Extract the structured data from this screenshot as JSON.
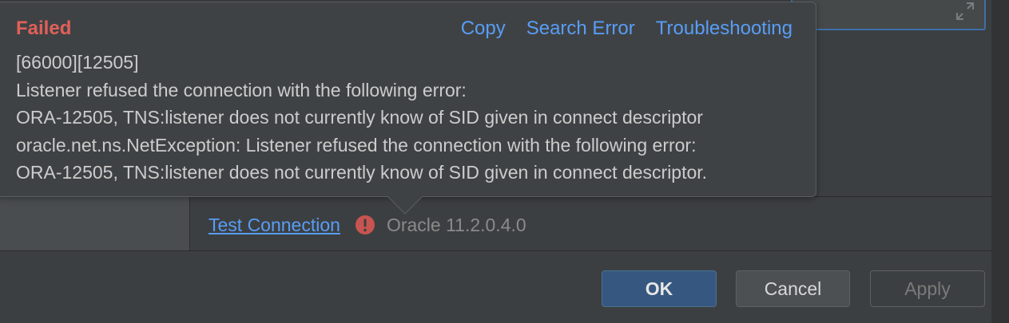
{
  "popup": {
    "status_title": "Failed",
    "actions": {
      "copy": "Copy",
      "search_error": "Search Error",
      "troubleshooting": "Troubleshooting"
    },
    "message_lines": [
      "[66000][12505]",
      "Listener refused the connection with the following error:",
      "ORA-12505, TNS:listener does not currently know of SID given in connect descriptor",
      "oracle.net.ns.NetException: Listener refused the connection with the following error:",
      "ORA-12505, TNS:listener does not currently know of SID given in connect descriptor."
    ]
  },
  "connection": {
    "test_link": "Test Connection",
    "status_icon": "error-icon",
    "version": "Oracle 11.2.0.4.0"
  },
  "footer": {
    "ok": "OK",
    "cancel": "Cancel",
    "apply": "Apply"
  },
  "colors": {
    "background": "#3c3f41",
    "error_red": "#e0605a",
    "link_blue": "#589df6",
    "ok_button": "#365880"
  }
}
